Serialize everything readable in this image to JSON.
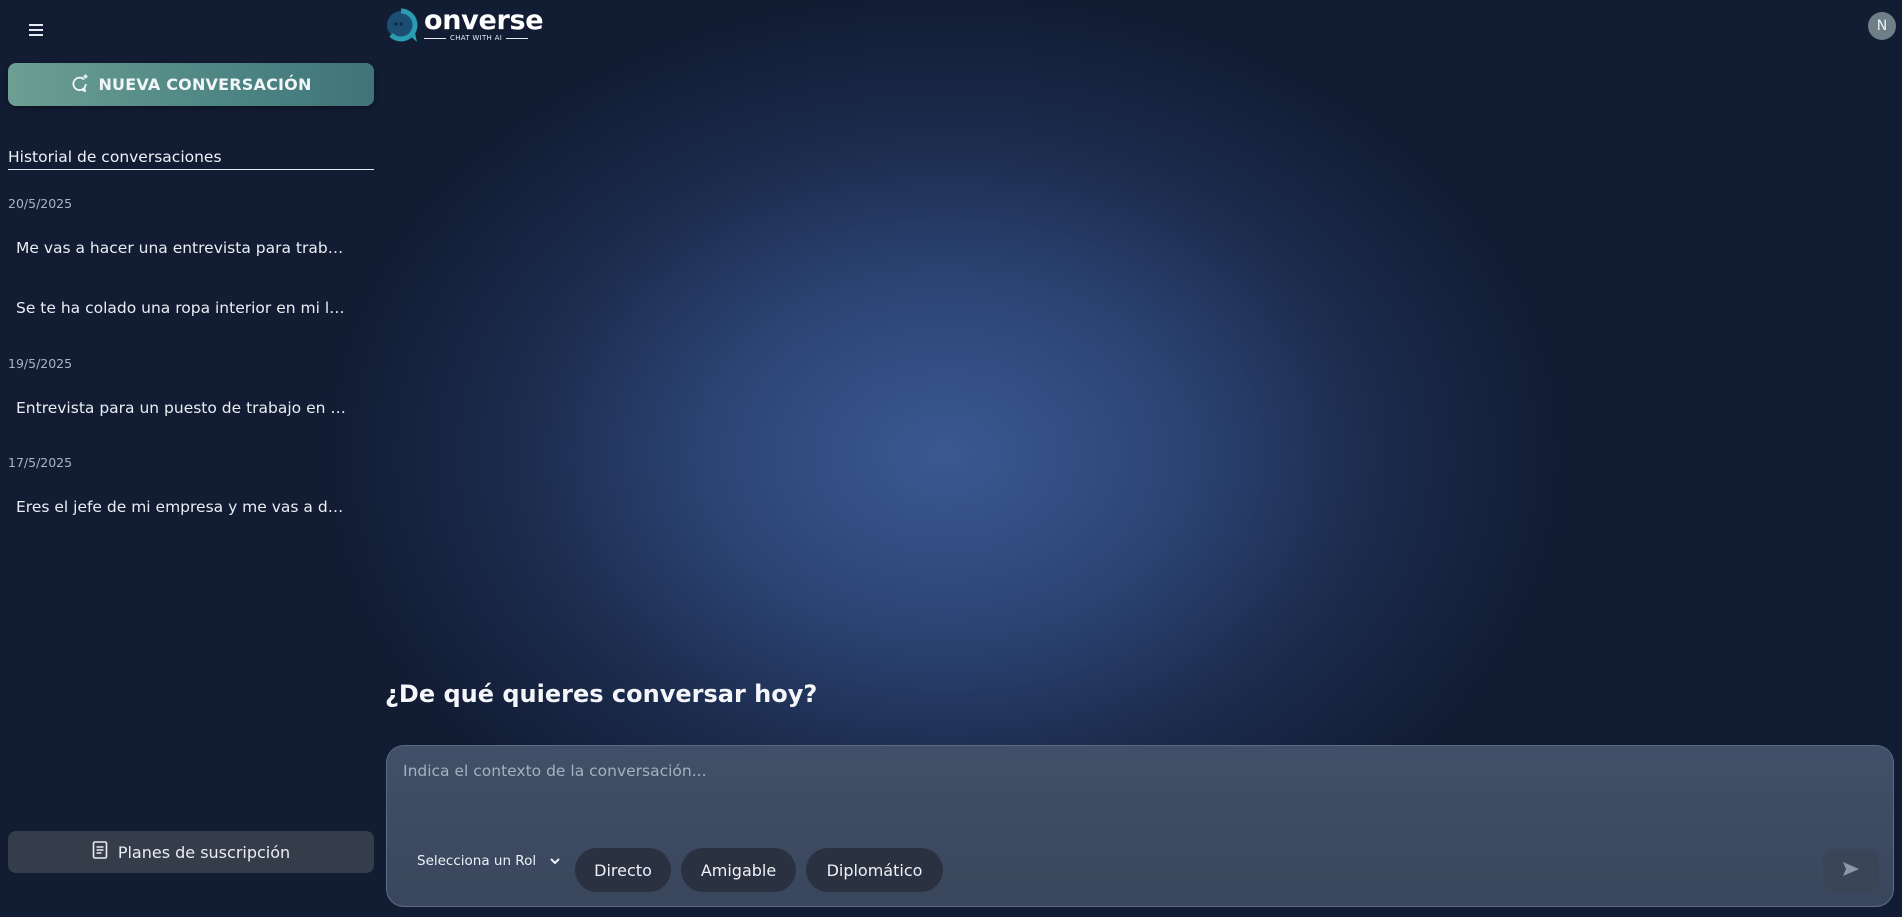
{
  "sidebar": {
    "new_conversation_label": "NUEVA CONVERSACIÓN",
    "history_title": "Historial de conversaciones",
    "groups": [
      {
        "date": "20/5/2025",
        "items": [
          "Me vas a hacer una entrevista para trabajo",
          "Se te ha colado una ropa interior en mi lavadora"
        ]
      },
      {
        "date": "19/5/2025",
        "items": [
          "Entrevista para un puesto de trabajo en una empresa"
        ]
      },
      {
        "date": "17/5/2025",
        "items": [
          "Eres el jefe de mi empresa y me vas a despedir"
        ]
      }
    ],
    "plans_label": "Planes de suscripción"
  },
  "header": {
    "logo_word": "onverse",
    "logo_tagline": "CHAT WITH AI",
    "avatar_initial": "N"
  },
  "main": {
    "headline": "¿De qué quieres conversar hoy?",
    "context_placeholder": "Indica el contexto de la conversación...",
    "role_select_label": "Selecciona un Rol",
    "tones": [
      "Directo",
      "Amigable",
      "Diplomático"
    ]
  },
  "colors": {
    "accent_teal": "#4f8785",
    "background_center": "#3a5992",
    "background_edge": "#121c33"
  },
  "icons": [
    "menu-icon",
    "chat-plus-icon",
    "document-icon",
    "chevron-down-icon",
    "send-icon"
  ]
}
